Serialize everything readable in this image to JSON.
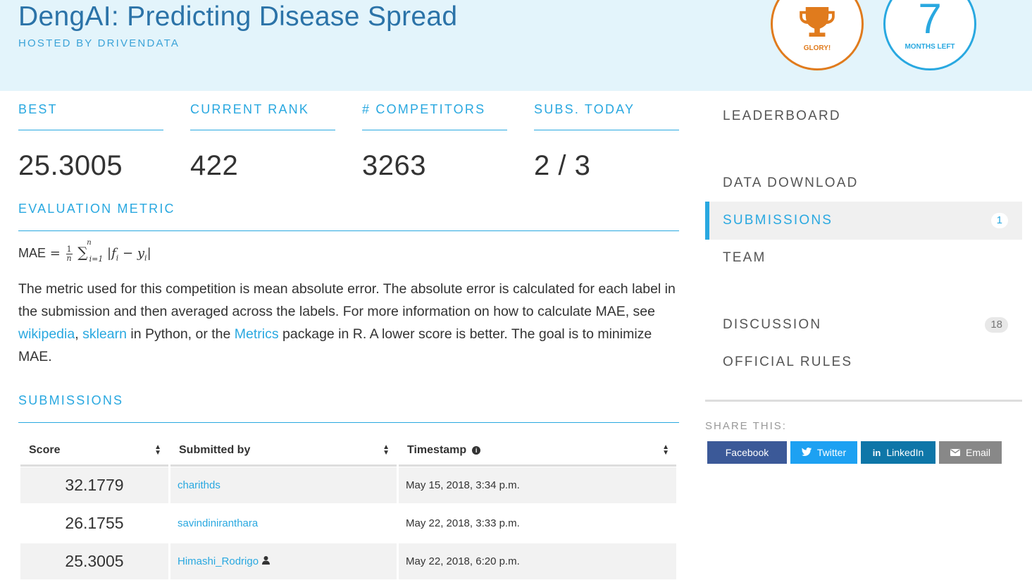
{
  "header": {
    "title": "DengAI: Predicting Disease Spread",
    "host": "HOSTED BY DRIVENDATA",
    "glory_label": "GLORY!",
    "months_value": "7",
    "months_label": "MONTHS LEFT",
    "colors": {
      "background": "#e3f4fb",
      "title": "#2b73a8",
      "glory": "#e07b1d",
      "months": "#29a8e0"
    }
  },
  "stats": {
    "best": {
      "label": "BEST",
      "value": "25.3005"
    },
    "rank": {
      "label": "CURRENT RANK",
      "value": "422"
    },
    "competitors": {
      "label": "# COMPETITORS",
      "value": "3263"
    },
    "subs_today": {
      "label": "SUBS. TODAY",
      "value": "2 / 3"
    }
  },
  "evaluation": {
    "title": "EVALUATION METRIC",
    "formula_name": "MAE",
    "text_1": "The metric used for this competition is mean absolute error. The absolute error is calculated for each label in the submission and then averaged across the labels. For more information on how to calculate MAE, see ",
    "link_wikipedia": "wikipedia",
    "sep": ", ",
    "link_sklearn": "sklearn",
    "text_2": " in Python, or the ",
    "link_metrics": "Metrics",
    "text_3": " package in R. A lower score is better. The goal is to minimize MAE."
  },
  "submissions": {
    "title": "SUBMISSIONS",
    "columns": {
      "score": "Score",
      "submitted_by": "Submitted by",
      "timestamp": "Timestamp"
    },
    "rows": [
      {
        "score": "32.1779",
        "user": "charithds",
        "timestamp": "May 15, 2018, 3:34 p.m."
      },
      {
        "score": "26.1755",
        "user": "savindiniranthara",
        "timestamp": "May 22, 2018, 3:33 p.m."
      },
      {
        "score": "25.3005",
        "user": "Himashi_Rodrigo",
        "timestamp": "May 22, 2018, 6:20 p.m."
      }
    ]
  },
  "sidebar": {
    "leaderboard": "LEADERBOARD",
    "data_download": "DATA DOWNLOAD",
    "submissions": "SUBMISSIONS",
    "submissions_count": "1",
    "team": "TEAM",
    "discussion": "DISCUSSION",
    "discussion_count": "18",
    "official_rules": "OFFICIAL RULES",
    "active_item": "SUBMISSIONS",
    "accent_color": "#29a8e0"
  },
  "share": {
    "label": "SHARE THIS:",
    "facebook": "Facebook",
    "twitter": "Twitter",
    "linkedin": "LinkedIn",
    "email": "Email",
    "colors": {
      "facebook": "#3b5998",
      "twitter": "#1da1f2",
      "linkedin": "#0e76a8",
      "email": "#888888"
    }
  }
}
